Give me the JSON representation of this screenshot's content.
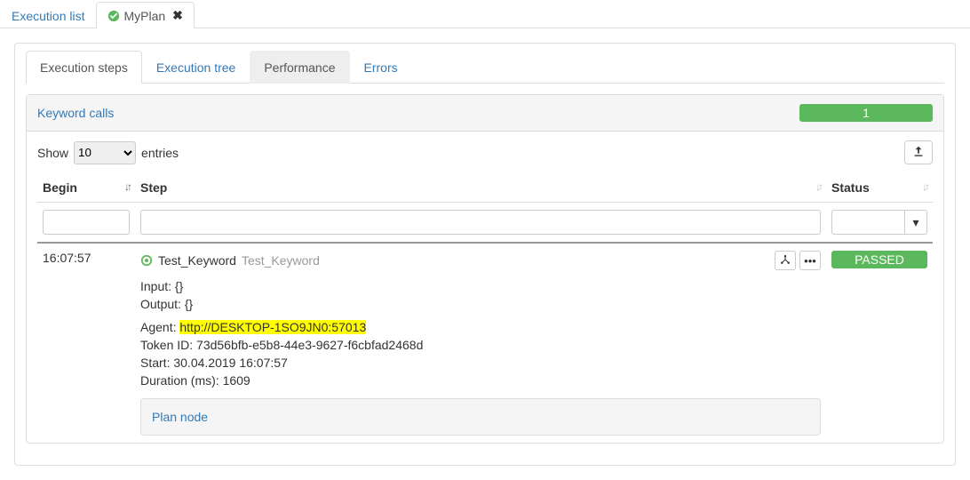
{
  "top_tabs": {
    "execution_list": "Execution list",
    "myplan": "MyPlan"
  },
  "inner_tabs": {
    "steps": "Execution steps",
    "tree": "Execution tree",
    "perf": "Performance",
    "errors": "Errors"
  },
  "keyword_calls": {
    "title": "Keyword calls",
    "count": "1"
  },
  "datatable": {
    "show": "Show",
    "entries": "entries",
    "length": "10",
    "columns": {
      "begin": "Begin",
      "step": "Step",
      "status": "Status"
    }
  },
  "row": {
    "begin": "16:07:57",
    "step_name": "Test_Keyword",
    "step_alias": "Test_Keyword",
    "status": "PASSED",
    "input_label": "Input:",
    "input_value": "{}",
    "output_label": "Output:",
    "output_value": "{}",
    "agent_label": "Agent:",
    "agent_value": "http://DESKTOP-1SO9JN0:57013",
    "token_label": "Token ID:",
    "token_value": "73d56bfb-e5b8-44e3-9627-f6cbfad2468d",
    "start_label": "Start:",
    "start_value": "30.04.2019 16:07:57",
    "duration_label": "Duration (ms):",
    "duration_value": "1609",
    "plan_node": "Plan node"
  },
  "icons": {
    "tree": "⋔",
    "dots": "•••",
    "caret": "▾",
    "export": "�約"
  }
}
